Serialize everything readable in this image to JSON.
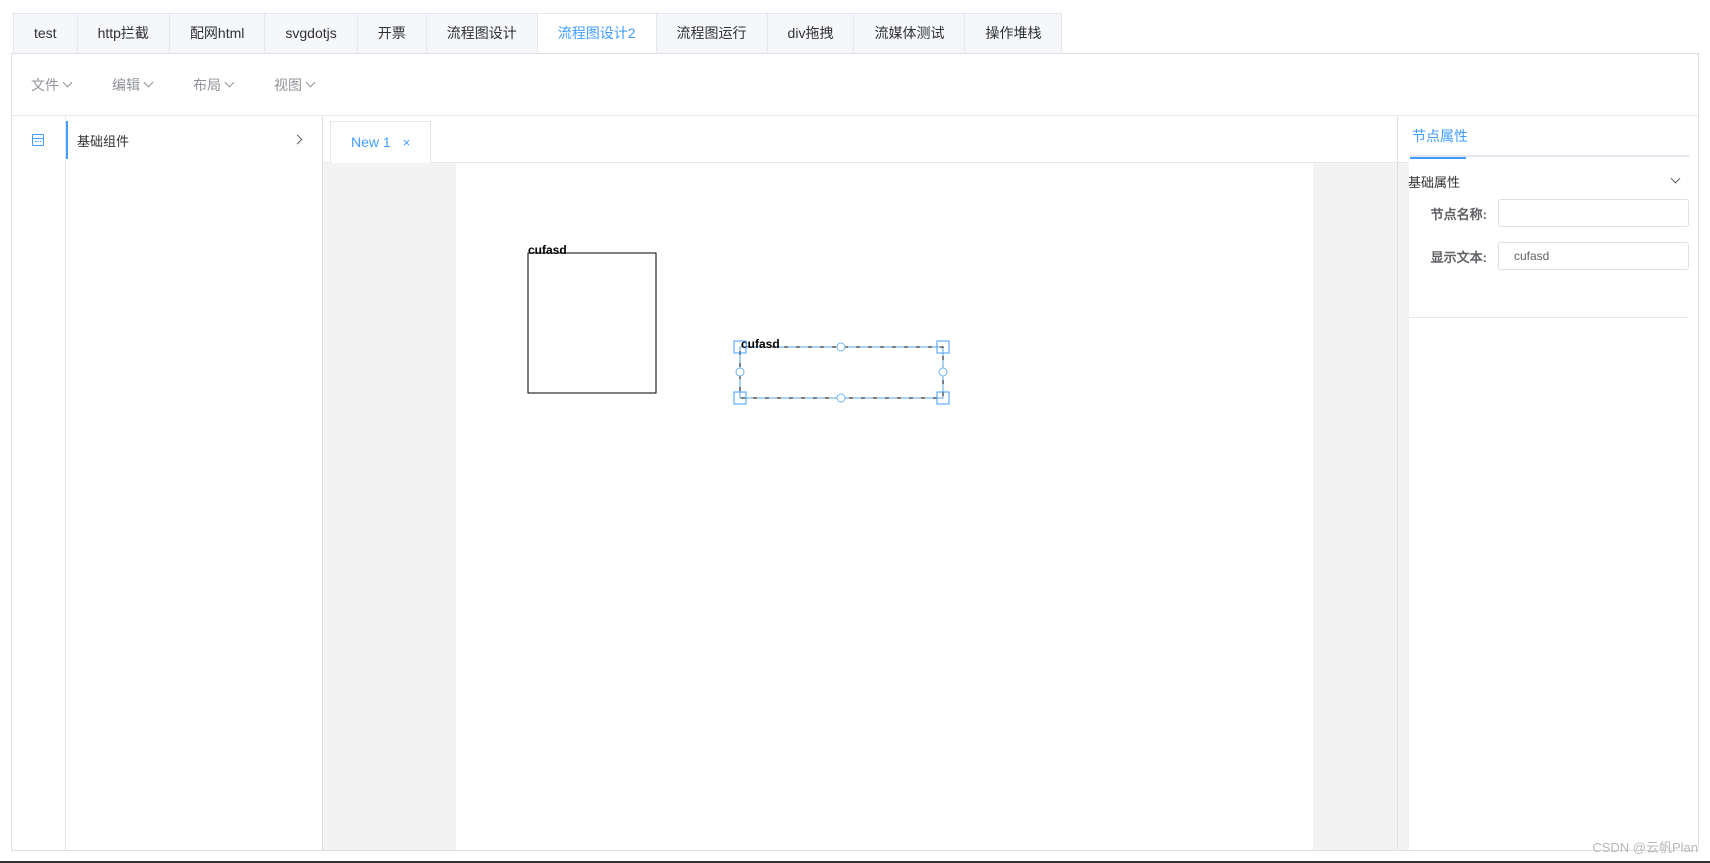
{
  "top_tabs": [
    {
      "label": "test",
      "active": false
    },
    {
      "label": "http拦截",
      "active": false
    },
    {
      "label": "配网html",
      "active": false
    },
    {
      "label": "svgdotjs",
      "active": false
    },
    {
      "label": "开票",
      "active": false
    },
    {
      "label": "流程图设计",
      "active": false
    },
    {
      "label": "流程图设计2",
      "active": true
    },
    {
      "label": "流程图运行",
      "active": false
    },
    {
      "label": "div拖拽",
      "active": false
    },
    {
      "label": "流媒体测试",
      "active": false
    },
    {
      "label": "操作堆栈",
      "active": false
    }
  ],
  "menubar": {
    "items": [
      "文件",
      "编辑",
      "布局",
      "视图"
    ]
  },
  "left_sidebar": {
    "icon": "calendar-icon",
    "components_group": "基础组件"
  },
  "editor": {
    "tabs": [
      {
        "label": "New 1",
        "close": "×"
      }
    ],
    "canvas": {
      "nodes": [
        {
          "name": "node-square",
          "label": "cufasd",
          "selected": false
        },
        {
          "name": "node-rect-selected",
          "label": "cufasd",
          "selected": true
        }
      ]
    }
  },
  "right_panel": {
    "tab": "节点属性",
    "section": "基础属性",
    "fields": [
      {
        "label": "节点名称:",
        "value": "",
        "placeholder": ""
      },
      {
        "label": "显示文本:",
        "value": "cufasd",
        "placeholder": ""
      }
    ]
  },
  "watermark": "CSDN @云帆Plan",
  "colors": {
    "accent": "#409eff",
    "canvas_bg": "#f3f3f3",
    "border": "#dcdfe6"
  }
}
